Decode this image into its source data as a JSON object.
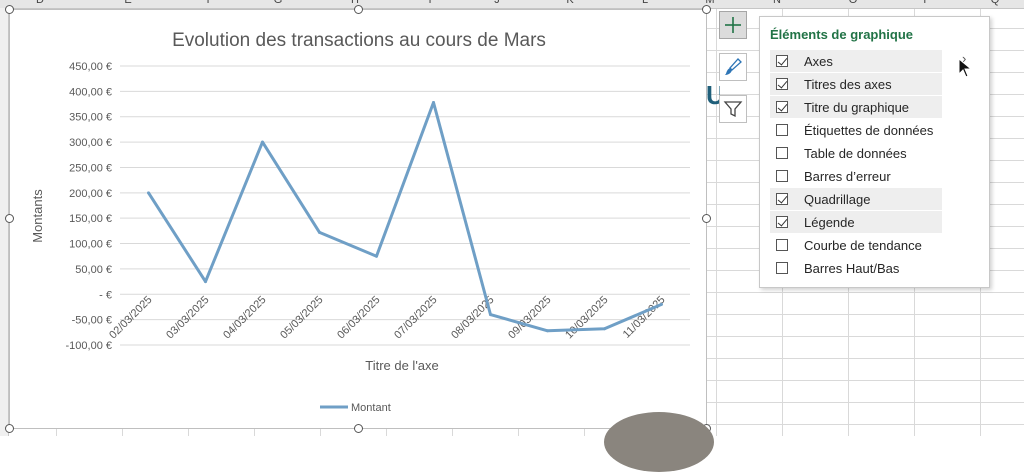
{
  "sheet": {
    "columns": [
      "D",
      "E",
      "F",
      "G",
      "H",
      "I",
      "J",
      "K",
      "L",
      "M",
      "N",
      "O",
      "P",
      "Q"
    ]
  },
  "chart_data": {
    "type": "line",
    "title": "Evolution des transactions au cours de Mars",
    "xlabel": "Titre de l'axe",
    "ylabel": "Montants",
    "categories": [
      "02/03/2025",
      "03/03/2025",
      "04/03/2025",
      "05/03/2025",
      "06/03/2025",
      "07/03/2025",
      "08/03/2025",
      "09/03/2025",
      "10/03/2025",
      "11/03/2025"
    ],
    "series": [
      {
        "name": "Montant",
        "values": [
          200,
          25,
          300,
          122,
          75,
          378,
          -40,
          -72,
          -68,
          -20
        ],
        "color": "#6f9fc6"
      }
    ],
    "y_ticks": [
      "450,00 €",
      "400,00 €",
      "350,00 €",
      "300,00 €",
      "250,00 €",
      "200,00 €",
      "150,00 €",
      "100,00 €",
      "50,00 €",
      "-  €",
      "-50,00 €",
      "-100,00 €"
    ],
    "ylim": [
      -100,
      450
    ],
    "grid": true,
    "legend": "bottom"
  },
  "panel": {
    "title": "Éléments de graphique",
    "items": [
      {
        "label": "Axes",
        "checked": true
      },
      {
        "label": "Titres des axes",
        "checked": true
      },
      {
        "label": "Titre du graphique",
        "checked": true
      },
      {
        "label": "Étiquettes de données",
        "checked": false
      },
      {
        "label": "Table de données",
        "checked": false
      },
      {
        "label": "Barres d’erreur",
        "checked": false
      },
      {
        "label": "Quadrillage",
        "checked": true
      },
      {
        "label": "Légende",
        "checked": true
      },
      {
        "label": "Courbe de tendance",
        "checked": false
      },
      {
        "label": "Barres Haut/Bas",
        "checked": false
      }
    ],
    "arrow": "›"
  },
  "background_text": {
    "us": "US"
  },
  "icons": {
    "add": "plus-icon",
    "style": "brush-icon",
    "filter": "funnel-icon"
  }
}
